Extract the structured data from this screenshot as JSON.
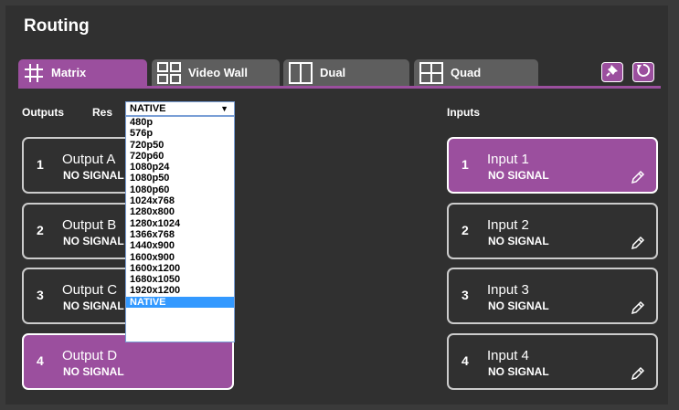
{
  "page": {
    "title": "Routing"
  },
  "tabs": [
    {
      "label": "Matrix",
      "icon": "grid-icon",
      "active": true
    },
    {
      "label": "Video Wall",
      "icon": "video-wall-icon",
      "active": false
    },
    {
      "label": "Dual",
      "icon": "dual-icon",
      "active": false
    },
    {
      "label": "Quad",
      "icon": "quad-icon",
      "active": false
    }
  ],
  "toolbar": {
    "pin_icon": "pin-icon",
    "refresh_icon": "refresh-icon"
  },
  "outputs": {
    "label": "Outputs",
    "res_label": "Res",
    "res_value": "NATIVE",
    "res_options": [
      "480p",
      "576p",
      "720p50",
      "720p60",
      "1080p24",
      "1080p50",
      "1080p60",
      "1024x768",
      "1280x800",
      "1280x1024",
      "1366x768",
      "1440x900",
      "1600x900",
      "1600x1200",
      "1680x1050",
      "1920x1200",
      "NATIVE"
    ],
    "items": [
      {
        "num": "1",
        "name": "Output A",
        "status": "NO SIGNAL",
        "active": false
      },
      {
        "num": "2",
        "name": "Output B",
        "status": "NO SIGNAL",
        "active": false
      },
      {
        "num": "3",
        "name": "Output C",
        "status": "NO SIGNAL",
        "active": false
      },
      {
        "num": "4",
        "name": "Output D",
        "status": "NO SIGNAL",
        "active": true
      }
    ]
  },
  "inputs": {
    "label": "Inputs",
    "items": [
      {
        "num": "1",
        "name": "Input 1",
        "status": "NO SIGNAL",
        "active": true
      },
      {
        "num": "2",
        "name": "Input 2",
        "status": "NO SIGNAL",
        "active": false
      },
      {
        "num": "3",
        "name": "Input 3",
        "status": "NO SIGNAL",
        "active": false
      },
      {
        "num": "4",
        "name": "Input 4",
        "status": "NO SIGNAL",
        "active": false
      }
    ]
  },
  "colors": {
    "accent": "#9b4f9e",
    "background": "#303030",
    "tab_inactive": "#5e5e5e",
    "selection": "#3399ff"
  }
}
